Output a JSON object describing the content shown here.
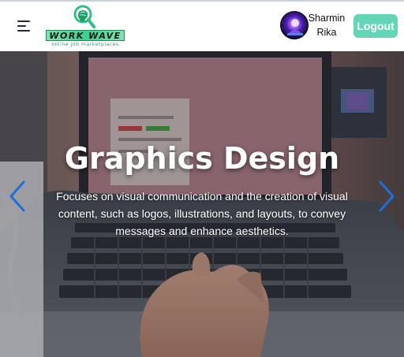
{
  "brand": {
    "name": "WORK WAVE",
    "tagline": "online job marketplaces",
    "icon": "brain-magnifier-icon",
    "accent": "#3ccf8e"
  },
  "user": {
    "name_line1": "Sharmin",
    "name_line2": "Rika",
    "avatar_icon": "purple-glow-avatar"
  },
  "nav": {
    "menu_icon": "hamburger-menu-icon",
    "logout_label": "Logout",
    "logout_color": "#64d6b7"
  },
  "slider": {
    "title": "Graphics Design",
    "description": "Focuses on visual communication and the creation of visual content, such as logos, illustrations, and layouts, to convey messages and enhance aesthetics.",
    "prev_icon": "chevron-left-icon",
    "next_icon": "chevron-right-icon",
    "arrow_color": "#1e6fd9"
  }
}
